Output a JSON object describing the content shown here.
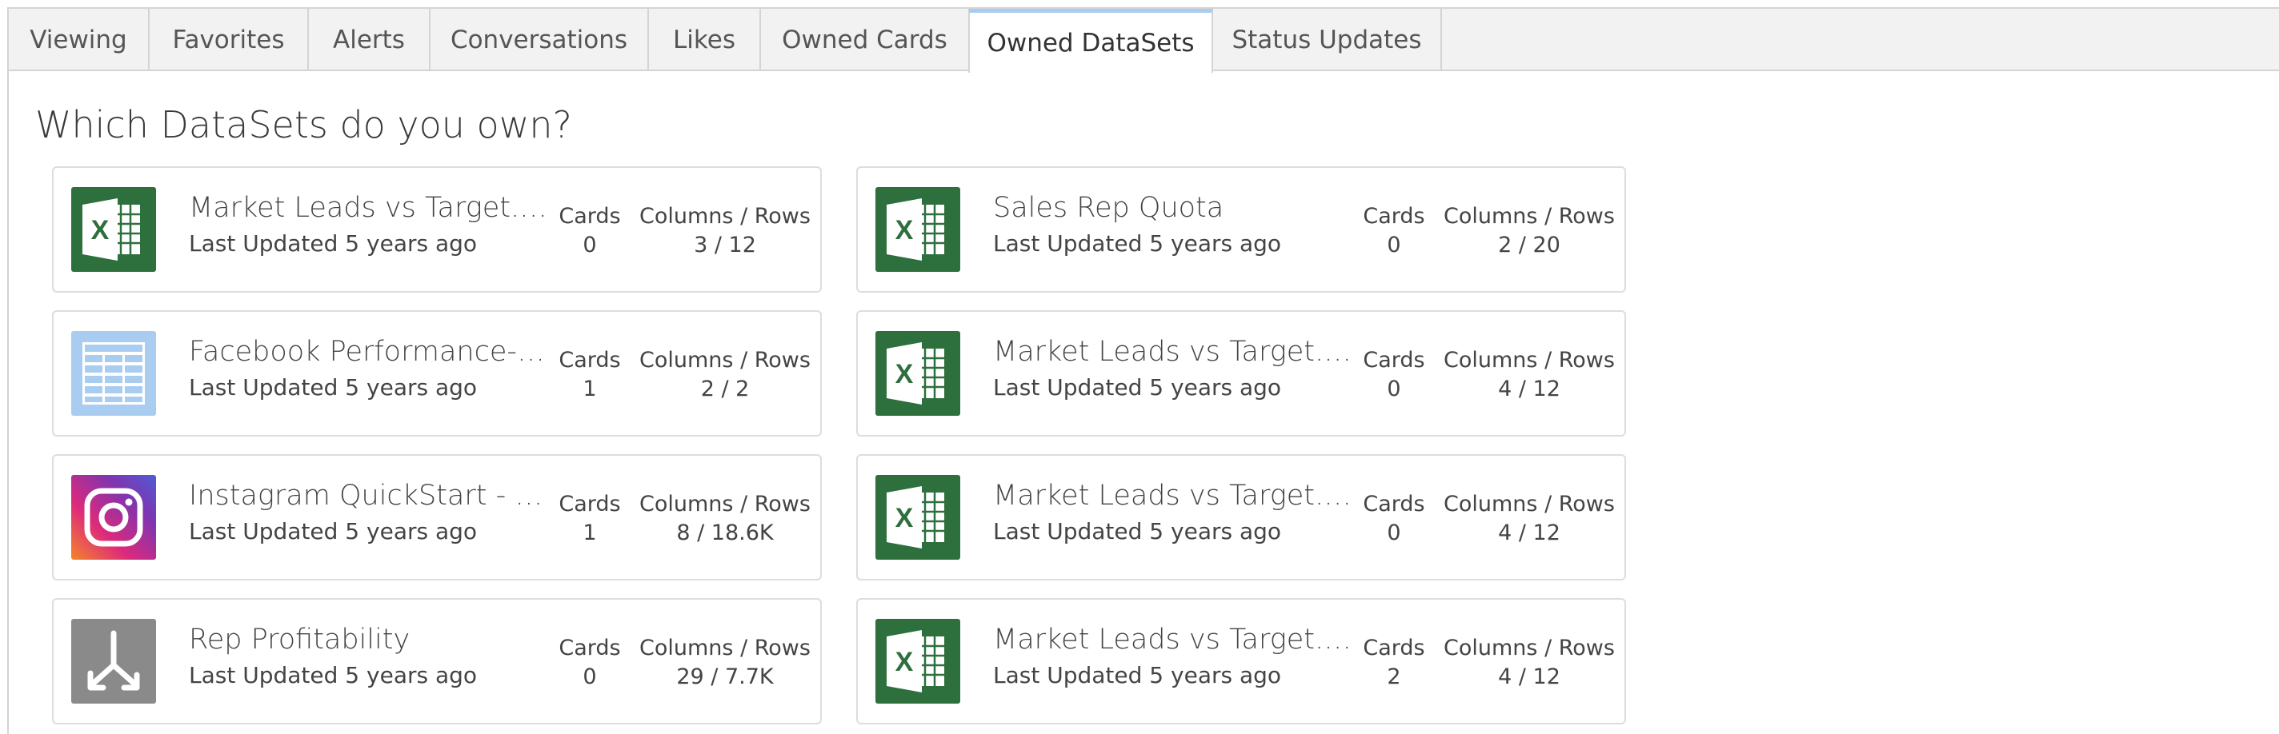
{
  "tabs": [
    {
      "label": "Viewing"
    },
    {
      "label": "Favorites"
    },
    {
      "label": "Alerts"
    },
    {
      "label": "Conversations"
    },
    {
      "label": "Likes"
    },
    {
      "label": "Owned Cards"
    },
    {
      "label": "Owned DataSets",
      "active": true
    },
    {
      "label": "Status Updates"
    }
  ],
  "heading": "Which DataSets do you own?",
  "stat_labels": {
    "cards": "Cards",
    "columns_rows": "Columns / Rows"
  },
  "datasets": [
    {
      "name": "Market Leads vs Target.xls...",
      "updated": "Last Updated 5 years ago",
      "cards": "0",
      "columns_rows": "3 / 12",
      "icon": "excel-icon"
    },
    {
      "name": "Sales Rep Quota",
      "updated": "Last Updated 5 years ago",
      "cards": "0",
      "columns_rows": "2 / 20",
      "icon": "excel-icon"
    },
    {
      "name": "Facebook Performance-P...",
      "updated": "Last Updated 5 years ago",
      "cards": "1",
      "columns_rows": "2 / 2",
      "icon": "table-icon"
    },
    {
      "name": "Market Leads vs Target.xls...",
      "updated": "Last Updated 5 years ago",
      "cards": "0",
      "columns_rows": "4 / 12",
      "icon": "excel-icon"
    },
    {
      "name": "Instagram QuickStart - Us...",
      "updated": "Last Updated 5 years ago",
      "cards": "1",
      "columns_rows": "8 / 18.6K",
      "icon": "instagram-icon"
    },
    {
      "name": "Market Leads vs Target.xls...",
      "updated": "Last Updated 5 years ago",
      "cards": "0",
      "columns_rows": "4 / 12",
      "icon": "excel-icon"
    },
    {
      "name": "Rep Profitability",
      "updated": "Last Updated 5 years ago",
      "cards": "0",
      "columns_rows": "29 / 7.7K",
      "icon": "dataflow-icon"
    },
    {
      "name": "Market Leads vs Target.xls...",
      "updated": "Last Updated 5 years ago",
      "cards": "2",
      "columns_rows": "4 / 12",
      "icon": "excel-icon"
    }
  ],
  "colors": {
    "excel_green": "#2e6f3e",
    "table_blue": "#a9cdf0",
    "dataflow_gray": "#8a8a8a",
    "active_tab_accent": "#a8cdee"
  }
}
